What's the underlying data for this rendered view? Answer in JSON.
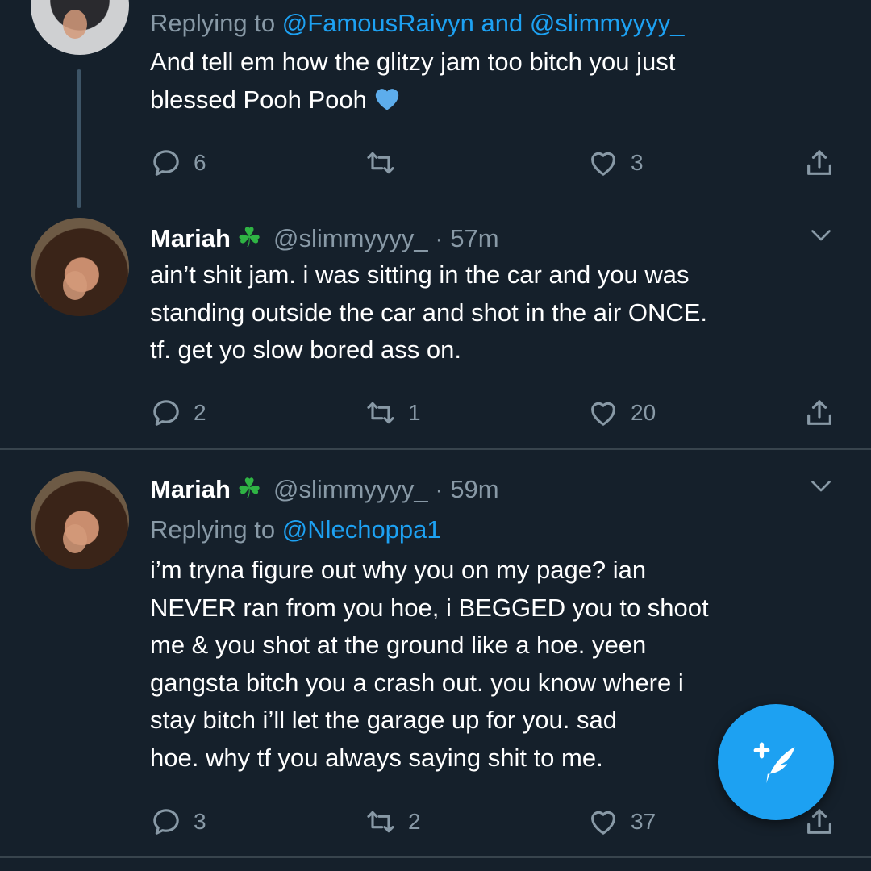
{
  "tweets": [
    {
      "replying_prefix": "Replying to ",
      "replying_mention_1": "@FamousRaivyn",
      "replying_and": " and ",
      "replying_mention_2": "@slimmyyyy_",
      "text_line_1": "And tell em how the glitzy jam too bitch you just",
      "text_line_2": "blessed Pooh Pooh",
      "emoji": "blue-heart-icon",
      "reply_count": "6",
      "retweet_count": "",
      "like_count": "3"
    },
    {
      "name": "Mariah",
      "badge": "☘",
      "handle": "@slimmyyyy_",
      "dot": "·",
      "time": "57m",
      "text_lines": [
        "ain’t shit jam. i was sitting in the car and you was",
        "standing outside the car and shot in the air ONCE.",
        "tf. get yo slow bored ass on."
      ],
      "reply_count": "2",
      "retweet_count": "1",
      "like_count": "20"
    },
    {
      "name": "Mariah",
      "badge": "☘",
      "handle": "@slimmyyyy_",
      "dot": "·",
      "time": "59m",
      "replying_prefix": "Replying to ",
      "replying_mention": "@Nlechoppa1",
      "text_lines": [
        "i’m tryna figure out why you on my page? ian",
        "NEVER ran from you hoe, i BEGGED you to shoot",
        "me & you shot at the ground like a hoe. yeen",
        "gangsta bitch you a crash out. you know where i",
        "stay bitch i’ll let the garage up for you. sad",
        "hoe. why tf you always saying shit to me."
      ],
      "reply_count": "3",
      "retweet_count": "2",
      "like_count": "37"
    }
  ],
  "icons": {
    "reply": "reply-icon",
    "retweet": "retweet-icon",
    "like": "heart-icon",
    "share": "share-icon",
    "more": "chevron-down-icon",
    "compose": "compose-tweet-icon"
  },
  "colors": {
    "background": "#15202b",
    "accent": "#1da1f2",
    "secondary_text": "#8899a6",
    "divider": "#38444d",
    "badge_green": "#2fb344"
  }
}
